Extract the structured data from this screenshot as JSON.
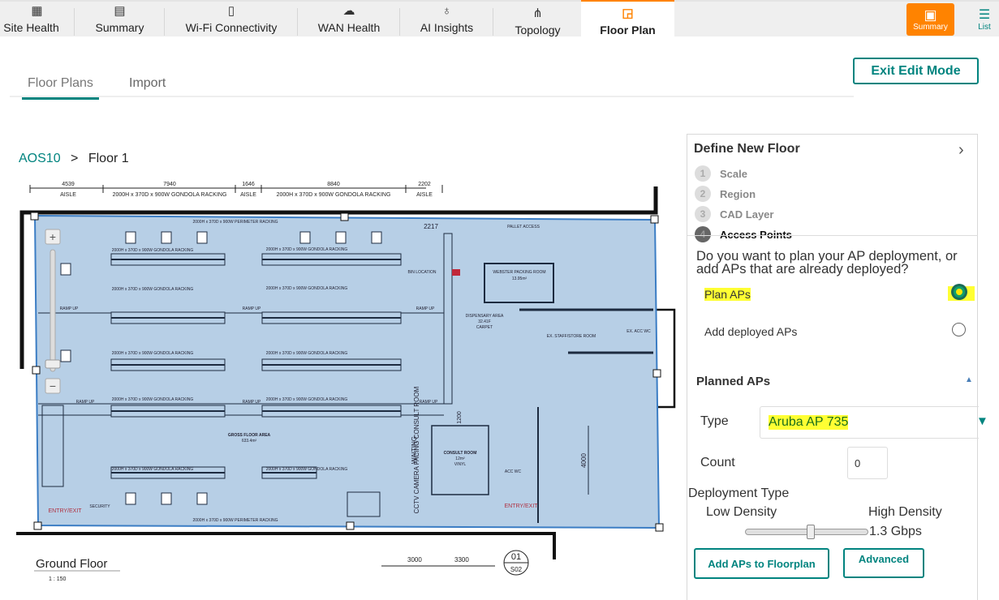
{
  "topnav": {
    "tabs": [
      {
        "label": "Site Health",
        "icon": "site-health-icon"
      },
      {
        "label": "Summary",
        "icon": "summary-icon"
      },
      {
        "label": "Wi-Fi Connectivity",
        "icon": "wifi-icon"
      },
      {
        "label": "WAN Health",
        "icon": "cloud-icon"
      },
      {
        "label": "AI Insights",
        "icon": "lightbulb-icon"
      },
      {
        "label": "Topology",
        "icon": "topology-icon"
      },
      {
        "label": "Floor Plan",
        "icon": "floor-plan-icon"
      }
    ],
    "active_tab": "Floor Plan",
    "view_summary": "Summary",
    "view_list": "List",
    "accent": "#ff8300"
  },
  "subtabs": {
    "items": [
      "Floor Plans",
      "Import"
    ],
    "active": "Floor Plans"
  },
  "exit_edit_mode": "Exit Edit Mode",
  "breadcrumb": {
    "parent": "AOS10",
    "separator": ">",
    "current": "Floor 1"
  },
  "floor_plan": {
    "dims": [
      {
        "value": "4539",
        "label": "AISLE"
      },
      {
        "value": "7940",
        "label": "2000H x 370D x 900W GONDOLA RACKING"
      },
      {
        "value": "1646",
        "label": "AISLE"
      },
      {
        "value": "8840",
        "label": "2000H x 370D x 900W GONDOLA RACKING"
      },
      {
        "value": "2202",
        "label": "AISLE"
      }
    ],
    "perimeter": "2000H x 370D x 900W PERIMETER RACKING",
    "gondola": "2000H x 370D x 900W GONDOLA RACKING",
    "ramp": "RAMP UP",
    "dim_2217": "2217",
    "pallet": "PALLET ACCESS",
    "bin": "BIN LOCATION",
    "webster": "WEBSTER PACKING ROOM",
    "webster_area": "13.95m²",
    "dispensary": "DISPENSARY AREA",
    "dispensary_area": "32.41F",
    "carpet": "CARPET",
    "staff": "EX. STAFF/STORE ROOM",
    "acc_wc": "EX. ACC WC",
    "gross": "GROSS FLOOR AREA",
    "gross_area": "633.4m²",
    "cctv": "CCTV CAMERA FACING CONSULT ROOM",
    "waiting": "WAITING",
    "consult": "CONSULT ROOM",
    "consult_area": "12m²",
    "vinyl": "VINYL",
    "accwc2": "ACC WC",
    "entry": "ENTRY/EXIT",
    "security": "SECURITY",
    "dim_1200": "1200",
    "dim_4000": "4000",
    "dim_3000": "3000",
    "dim_3300": "3300",
    "ref_top": "01",
    "ref_bottom": "S02",
    "title": "Ground Floor",
    "scale": "1 : 150"
  },
  "panel": {
    "title": "Define New Floor",
    "steps": [
      {
        "n": "1",
        "label": "Scale"
      },
      {
        "n": "2",
        "label": "Region"
      },
      {
        "n": "3",
        "label": "CAD Layer"
      },
      {
        "n": "4",
        "label": "Access Points"
      }
    ],
    "question": "Do you want to plan your AP deployment, or add APs that are already deployed?",
    "options": [
      {
        "label": "Plan APs",
        "selected": true
      },
      {
        "label": "Add deployed APs",
        "selected": false
      }
    ],
    "planned_title": "Planned APs",
    "type_label": "Type",
    "type_value": "Aruba AP 735",
    "count_label": "Count",
    "count_value": "0",
    "deployment_label": "Deployment Type",
    "low": "Low Density",
    "high": "High Density",
    "slider_fraction": 0.53,
    "throughput": "1.3 Gbps",
    "add_button": "Add APs to Floorplan",
    "advanced_button": "Advanced"
  }
}
